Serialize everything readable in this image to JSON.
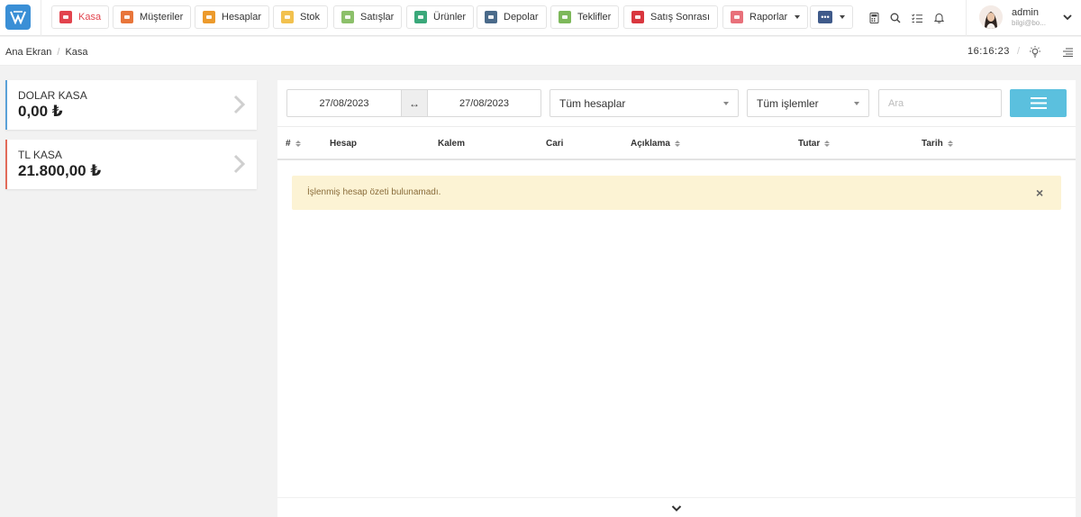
{
  "nav": {
    "items": [
      {
        "label": "Kasa",
        "color": "#e2434d",
        "active": true
      },
      {
        "label": "Müşteriler",
        "color": "#e8753a"
      },
      {
        "label": "Hesaplar",
        "color": "#ec9a2c"
      },
      {
        "label": "Stok",
        "color": "#f2c14e"
      },
      {
        "label": "Satışlar",
        "color": "#8cc06a"
      },
      {
        "label": "Ürünler",
        "color": "#3aa87a"
      },
      {
        "label": "Depolar",
        "color": "#4a6a8a"
      },
      {
        "label": "Teklifler",
        "color": "#7db85a"
      },
      {
        "label": "Satış Sonrası",
        "color": "#d9363e"
      },
      {
        "label": "Raporlar",
        "color": "#e8707a"
      }
    ],
    "more_label": "•••",
    "more_color": "#3f5a8a"
  },
  "user": {
    "name": "admin",
    "subtitle": "bilgi@bo..."
  },
  "breadcrumb": {
    "home": "Ana Ekran",
    "current": "Kasa"
  },
  "clock": "16:16:23",
  "kasalar": [
    {
      "name": "DOLAR KASA",
      "amount": "0,00 ₺",
      "accent": "#5aa1d8"
    },
    {
      "name": "TL KASA",
      "amount": "21.800,00 ₺",
      "accent": "#e26b5a"
    }
  ],
  "filters": {
    "date_from": "27/08/2023",
    "date_to": "27/08/2023",
    "date_arrow": "↔",
    "account_select": "Tüm hesaplar",
    "operation_select": "Tüm işlemler",
    "search_placeholder": "Ara"
  },
  "table": {
    "columns": [
      "#",
      "Hesap",
      "Kalem",
      "Cari",
      "Açıklama",
      "Tutar",
      "Tarih"
    ]
  },
  "alert": {
    "text": "İşlenmiş hesap özeti bulunamadı.",
    "close": "×"
  },
  "colors": {
    "accent_blue": "#5bc0de",
    "alert_bg": "#fcf3d4"
  }
}
